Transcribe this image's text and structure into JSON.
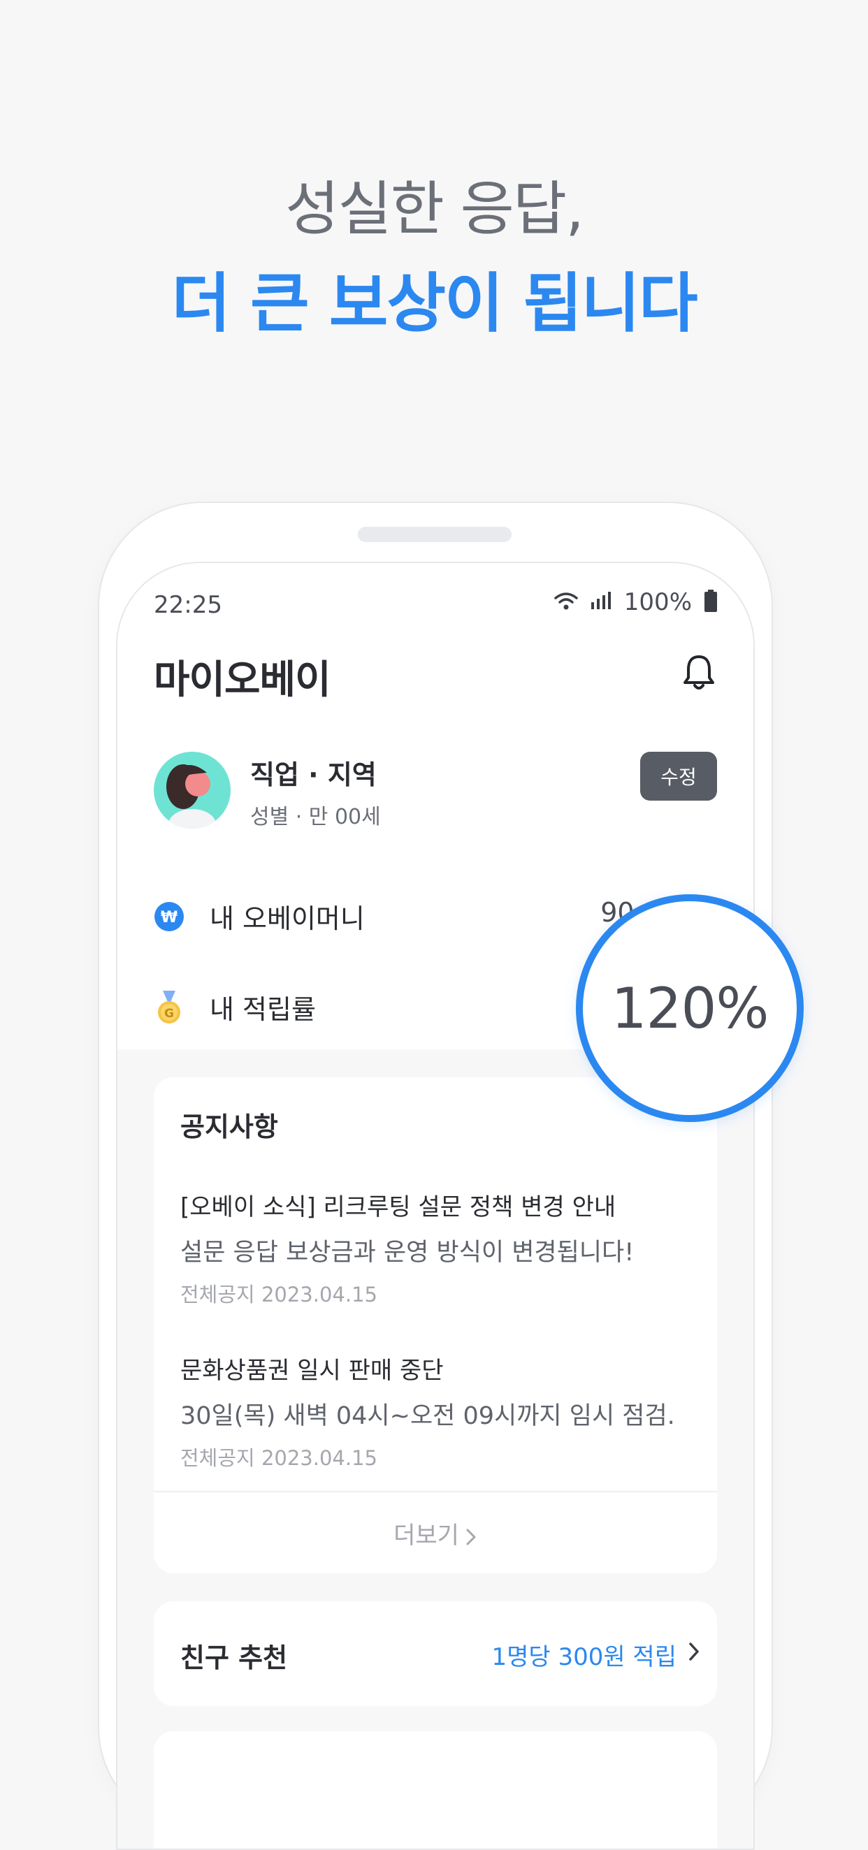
{
  "headline": {
    "line1": "성실한 응답,",
    "line2": "더 큰 보상이 됩니다"
  },
  "status_bar": {
    "time": "22:25",
    "battery": "100%",
    "icons": [
      "wifi-icon",
      "signal-icon",
      "battery-icon"
    ]
  },
  "app": {
    "title": "마이오베이"
  },
  "profile": {
    "name": "직업 · 지역",
    "sub": "성별 · 만 00세",
    "edit_label": "수정"
  },
  "money_row": {
    "label": "내 오베이머니",
    "value": "90,00"
  },
  "rate_row": {
    "label": "내 적립률",
    "value": "120%"
  },
  "notices": {
    "title": "공지사항",
    "items": [
      {
        "title": "[오베이 소식] 리크루팅 설문 정책 변경 안내",
        "body": "설문 응답 보상금과 운영 방식이 변경됩니다!",
        "meta": "전체공지 2023.04.15"
      },
      {
        "title": "문화상품권 일시 판매 중단",
        "body": "30일(목) 새벽 04시~오전 09시까지 임시 점검.",
        "meta": "전체공지 2023.04.15"
      }
    ],
    "more_label": "더보기"
  },
  "referral": {
    "label": "친구 추천",
    "value": "1명당 300원 적립"
  },
  "colors": {
    "accent": "#2b88f0",
    "headline_gray": "#6b6f78",
    "background": "#f7f7f8",
    "button_dark": "#585c64"
  }
}
